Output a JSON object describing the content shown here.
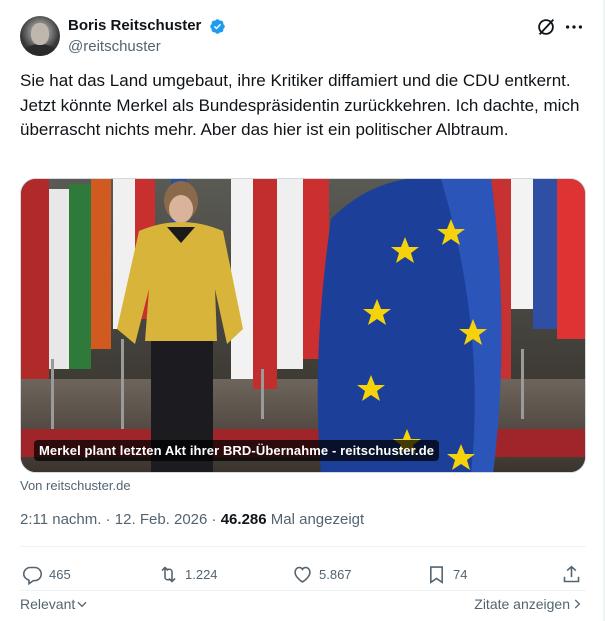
{
  "author": {
    "display_name": "Boris Reitschuster",
    "handle": "@reitschuster",
    "verified": true
  },
  "tweet": {
    "text": "Sie hat das Land umgebaut, ihre Kritiker diffamiert und die CDU entkernt. Jetzt könnte Merkel als Bundespräsidentin zurückkehren. Ich dachte, mich überrascht nichts mehr. Aber das hier ist ein politischer Albtraum."
  },
  "media": {
    "caption": "Merkel plant letzten Akt ihrer BRD-Übernahme - reitschuster.de",
    "source": "Von reitschuster.de"
  },
  "meta": {
    "time": "2:11 nachm.",
    "date": "12. Feb. 2026",
    "views": "46.286",
    "views_label": "Mal angezeigt"
  },
  "actions": {
    "replies": "465",
    "reposts": "1.224",
    "likes": "5.867",
    "bookmarks": "74"
  },
  "footer": {
    "relevant_label": "Relevant",
    "quotes_label": "Zitate anzeigen"
  },
  "colors": {
    "verified": "#1d9bf0",
    "secondary_text": "#536471",
    "primary_text": "#0f1419"
  },
  "icons": [
    "grok-icon",
    "more-icon",
    "verified-badge-icon",
    "reply-icon",
    "repost-icon",
    "like-icon",
    "bookmark-icon",
    "share-icon",
    "chevron-down-icon",
    "chevron-right-icon"
  ]
}
